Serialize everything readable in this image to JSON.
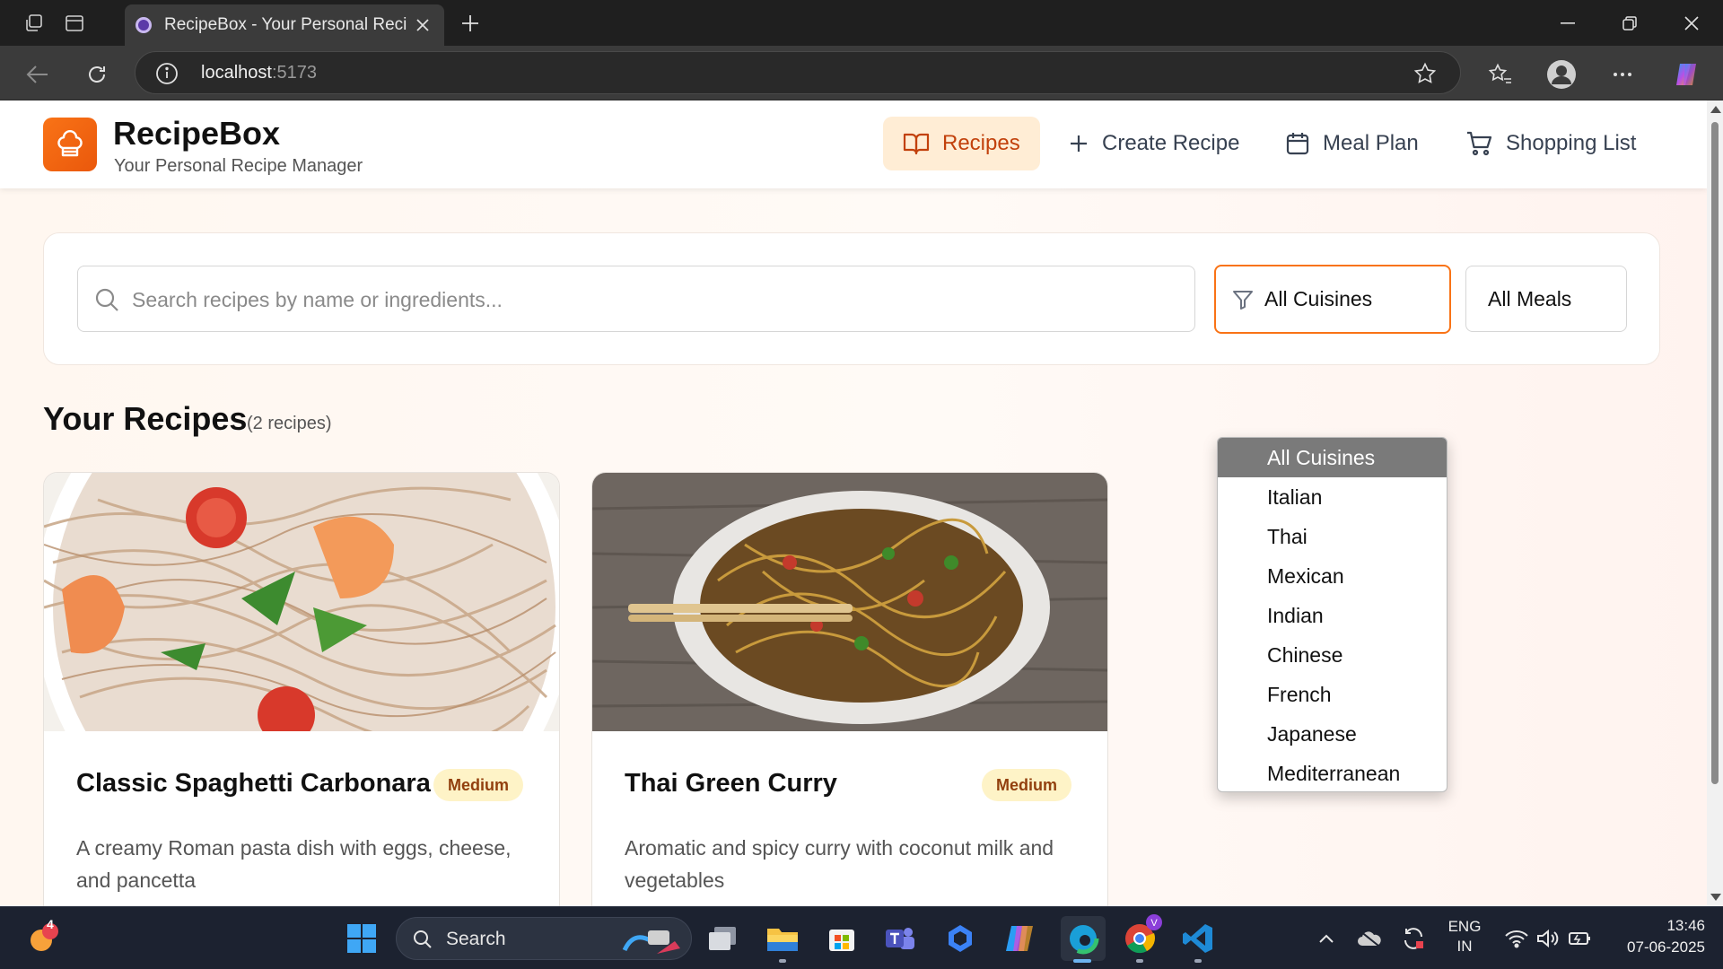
{
  "browser": {
    "tab_title": "RecipeBox - Your Personal Recipe",
    "url_host": "localhost",
    "url_port": ":5173"
  },
  "header": {
    "brand": "RecipeBox",
    "tagline": "Your Personal Recipe Manager",
    "nav": {
      "recipes": "Recipes",
      "create": "Create Recipe",
      "meal_plan": "Meal Plan",
      "shopping": "Shopping List"
    }
  },
  "filters": {
    "search_placeholder": "Search recipes by name or ingredients...",
    "cuisine_selected": "All Cuisines",
    "meal_selected": "All Meals",
    "cuisine_options": [
      "All Cuisines",
      "Italian",
      "Thai",
      "Mexican",
      "Indian",
      "Chinese",
      "French",
      "Japanese",
      "Mediterranean"
    ]
  },
  "section": {
    "title": "Your Recipes",
    "count": "(2 recipes)"
  },
  "recipes": [
    {
      "title": "Classic Spaghetti Carbonara",
      "difficulty": "Medium",
      "description": "A creamy Roman pasta dish with eggs, cheese, and pancetta"
    },
    {
      "title": "Thai Green Curry",
      "difficulty": "Medium",
      "description": "Aromatic and spicy curry with coconut milk and vegetables"
    }
  ],
  "taskbar": {
    "search_label": "Search",
    "notification_count": "4",
    "language": "ENG",
    "region": "IN",
    "time": "13:46",
    "date": "07-06-2025"
  },
  "colors": {
    "accent": "#f97316",
    "accent_dark": "#c2410c",
    "badge_bg": "#fef3c7"
  }
}
